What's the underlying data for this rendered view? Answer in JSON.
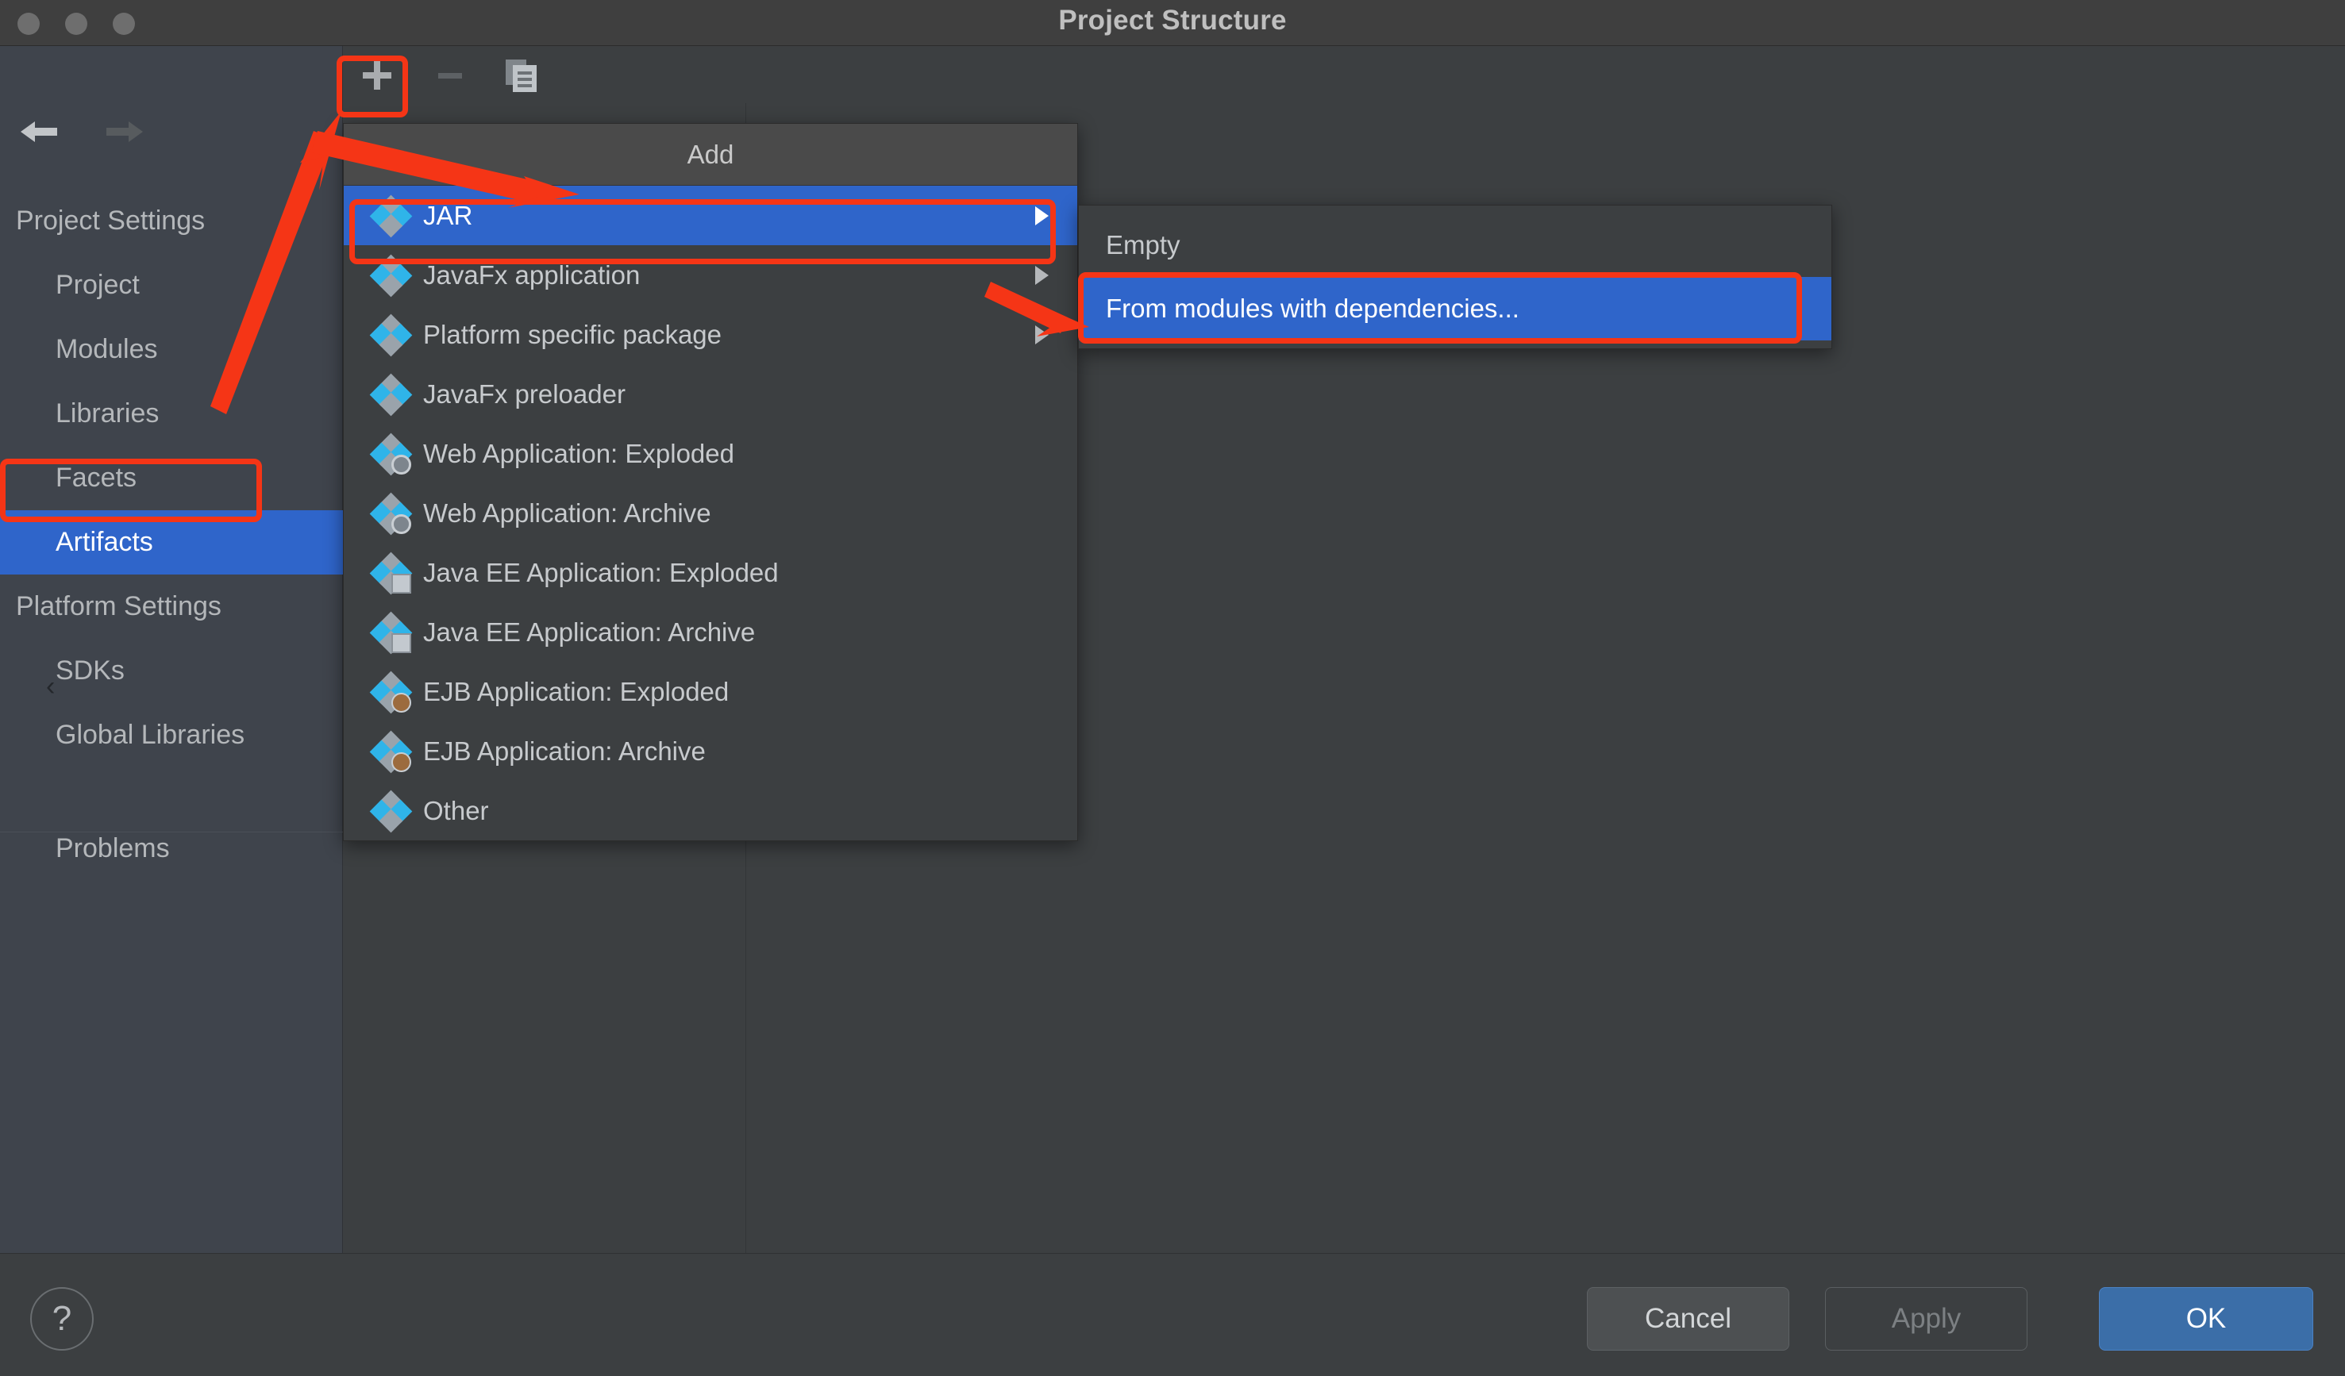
{
  "window": {
    "title": "Project Structure",
    "traffic_lights": [
      "close-button",
      "minimize-button",
      "maximize-button"
    ]
  },
  "colors": {
    "accent_selection": "#2f65ca",
    "annotation_red": "#f53516",
    "ok_button": "#3b6ea8",
    "icon_cyan": "#2fb4e9",
    "icon_gray": "#9aa3ab",
    "sidebar_bg": "#3f444c",
    "content_bg": "#3c3f41",
    "titlebar_bg": "#3f3f3f"
  },
  "nav": {
    "back_label": "back-arrow",
    "forward_label": "forward-arrow"
  },
  "sidebar": {
    "groups": [
      {
        "label": "Project Settings",
        "type": "group",
        "selected": false
      },
      {
        "label": "Project",
        "type": "child",
        "selected": false
      },
      {
        "label": "Modules",
        "type": "child",
        "selected": false
      },
      {
        "label": "Libraries",
        "type": "child",
        "selected": false
      },
      {
        "label": "Facets",
        "type": "child",
        "selected": false
      },
      {
        "label": "Artifacts",
        "type": "child",
        "selected": true
      },
      {
        "label": "Platform Settings",
        "type": "group",
        "selected": false
      },
      {
        "label": "SDKs",
        "type": "child",
        "selected": false
      },
      {
        "label": "Global Libraries",
        "type": "child",
        "selected": false
      },
      {
        "label": "Problems",
        "type": "child",
        "selected": false
      }
    ],
    "collapse_chevron": "‹"
  },
  "toolbar": {
    "add_label": "+",
    "remove_label": "−",
    "copy_label": "copy"
  },
  "menu": {
    "header": "Add",
    "items": [
      {
        "label": "JAR",
        "icon": "artifact-jar-icon",
        "submenu": true,
        "selected": true
      },
      {
        "label": "JavaFx application",
        "icon": "artifact-javafx-icon",
        "submenu": true,
        "selected": false
      },
      {
        "label": "Platform specific package",
        "icon": "artifact-platform-icon",
        "submenu": true,
        "selected": false
      },
      {
        "label": "JavaFx preloader",
        "icon": "artifact-javafx-preloader-icon",
        "submenu": false,
        "selected": false
      },
      {
        "label": "Web Application: Exploded",
        "icon": "artifact-web-exploded-icon",
        "submenu": false,
        "selected": false
      },
      {
        "label": "Web Application: Archive",
        "icon": "artifact-web-archive-icon",
        "submenu": false,
        "selected": false
      },
      {
        "label": "Java EE Application: Exploded",
        "icon": "artifact-javaee-exploded-icon",
        "submenu": false,
        "selected": false
      },
      {
        "label": "Java EE Application: Archive",
        "icon": "artifact-javaee-archive-icon",
        "submenu": false,
        "selected": false
      },
      {
        "label": "EJB Application: Exploded",
        "icon": "artifact-ejb-exploded-icon",
        "submenu": false,
        "selected": false
      },
      {
        "label": "EJB Application: Archive",
        "icon": "artifact-ejb-archive-icon",
        "submenu": false,
        "selected": false
      },
      {
        "label": "Other",
        "icon": "artifact-other-icon",
        "submenu": false,
        "selected": false
      }
    ]
  },
  "submenu": {
    "items": [
      {
        "label": "Empty",
        "selected": false
      },
      {
        "label": "From modules with dependencies...",
        "selected": true
      }
    ]
  },
  "footer": {
    "help_label": "?",
    "cancel_label": "Cancel",
    "apply_label": "Apply",
    "ok_label": "OK"
  },
  "annotations": {
    "highlight_boxes": [
      "add-button-box",
      "artifacts-sidebar-box",
      "jar-menu-item-box",
      "from-modules-submenu-box"
    ],
    "arrows": [
      "arrow-to-add-button",
      "arrow-to-add-header",
      "arrow-to-from-modules"
    ]
  }
}
